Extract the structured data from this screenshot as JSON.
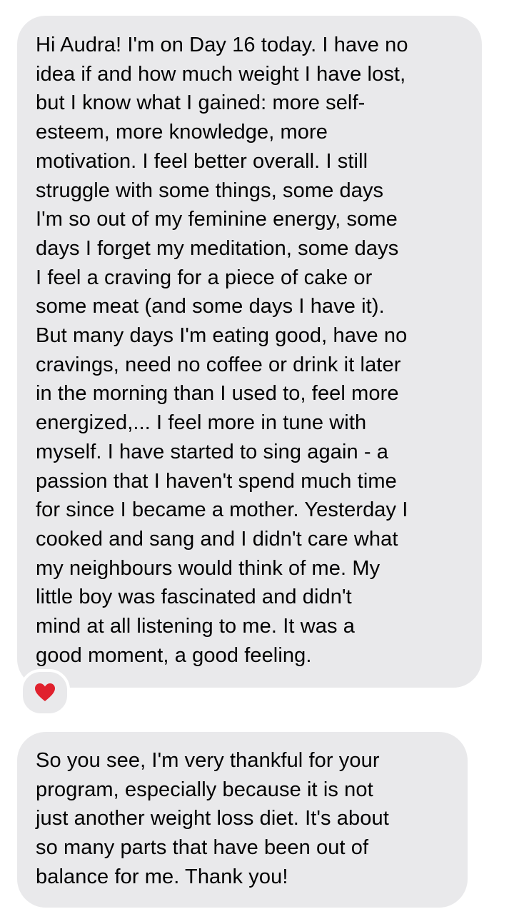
{
  "messages": [
    {
      "id": "message-1",
      "lines": [
        "Hi Audra! I'm on Day 16 today. I have no",
        "idea if and how much weight I have lost,",
        "but I know what I gained: more self-",
        "esteem, more knowledge, more",
        "motivation. I feel better overall. I still",
        "struggle with some things, some days",
        "I'm so out of my feminine energy, some",
        "days I forget my meditation, some days",
        "I feel a craving for a piece of cake or",
        "some meat (and some days I have it).",
        "But many days I'm eating good, have no",
        "cravings, need no coffee or drink it later",
        "in the morning than I used to, feel more",
        "energized,... I feel more in tune with",
        "myself. I have started to sing again - a",
        "passion that I haven't spend much time",
        "for since I became a mother. Yesterday I",
        "cooked and sang and I didn't care what",
        "my neighbours would think of me. My",
        "little boy was fascinated and didn't",
        "mind at all listening to me. It was a",
        "good moment, a good feeling."
      ],
      "reaction": {
        "icon": "heart-icon",
        "color": "#e0212d"
      }
    },
    {
      "id": "message-2",
      "lines": [
        "So you see, I'm very thankful for your",
        "program, especially because it is not",
        "just another weight loss diet. It's about",
        "so many parts that have been out of",
        "balance for me. Thank you!"
      ]
    }
  ],
  "colors": {
    "bubble_background": "#e9e9eb",
    "text": "#000000",
    "background": "#ffffff"
  }
}
